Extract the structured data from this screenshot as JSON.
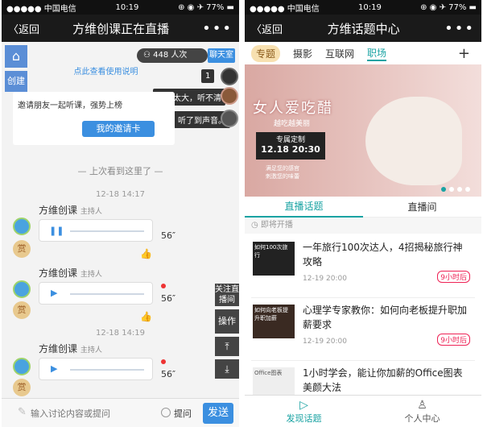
{
  "left": {
    "status": {
      "carrier": "●●●●● 中国电信 ",
      "time": "10:19",
      "battery": "⊕ ◉ ✈ 77% ▬"
    },
    "nav": {
      "back": "〈返回",
      "title": "方维创课正在直播",
      "more": "•••"
    },
    "side": {
      "home": "⌂",
      "create": "创建"
    },
    "viewers": {
      "count": "448 人次",
      "chatroom": "聊天室"
    },
    "help_link": "点此查看使用说明",
    "chat_bubbles": [
      {
        "num": "1"
      },
      {
        "text": "回音太大，听不清"
      },
      {
        "text": "听了到声音。"
      }
    ],
    "invite": {
      "text": "邀请朋友一起听课，强势上榜",
      "button": "我的邀请卡"
    },
    "last_seen": "— 上次看到这里了 —",
    "messages": [
      {
        "time": "12-18 14:17",
        "name": "方维创课",
        "role": "主持人",
        "duration": "56″",
        "shang": "赏"
      },
      {
        "time": "",
        "name": "方维创课",
        "role": "主持人",
        "duration": "56″",
        "shang": "赏"
      },
      {
        "time": "12-18 14:19",
        "name": "方维创课",
        "role": "主持人",
        "duration": "56″",
        "shang": "赏"
      }
    ],
    "right_tools": {
      "follow": "关注直播间",
      "ops": "操作"
    },
    "input": {
      "placeholder": "输入讨论内容或提问",
      "ask": "提问",
      "send": "发送"
    }
  },
  "right": {
    "status": {
      "carrier": "●●●●● 中国电信 ",
      "time": "10:19",
      "battery": "⊕ ◉ ✈ 77% ▬"
    },
    "nav": {
      "back": "〈返回",
      "title": "方维话题中心",
      "more": "•••"
    },
    "tabs": [
      "专题",
      "摄影",
      "互联网",
      "职场"
    ],
    "plus": "+",
    "banner": {
      "headline": "女人爱吃醋",
      "sub": "越吃越美丽",
      "label": "专属定制",
      "date": "12.18 20:30",
      "tag1": "满足您的感官",
      "tag2": "刺激您的味蕾"
    },
    "subtabs": [
      "直播话题",
      "直播间"
    ],
    "upcoming": "即将开播",
    "items": [
      {
        "title": "一年旅行100次达人，4招揭秘旅行神攻略",
        "meta": "12-19 20:00",
        "badge": "9小时后",
        "thumb": "如何100次旅行"
      },
      {
        "title": "心理学专家教你：如何向老板提升职加薪要求",
        "meta": "12-19 20:00",
        "badge": "9小时后",
        "thumb": "如何向老板提升职加薪"
      },
      {
        "title": "1小时学会，能让你加薪的Office图表美颜大法",
        "meta": "",
        "badge": "",
        "thumb": "Office图表"
      }
    ],
    "bottom": {
      "discover": "发现话题",
      "profile": "个人中心"
    }
  }
}
